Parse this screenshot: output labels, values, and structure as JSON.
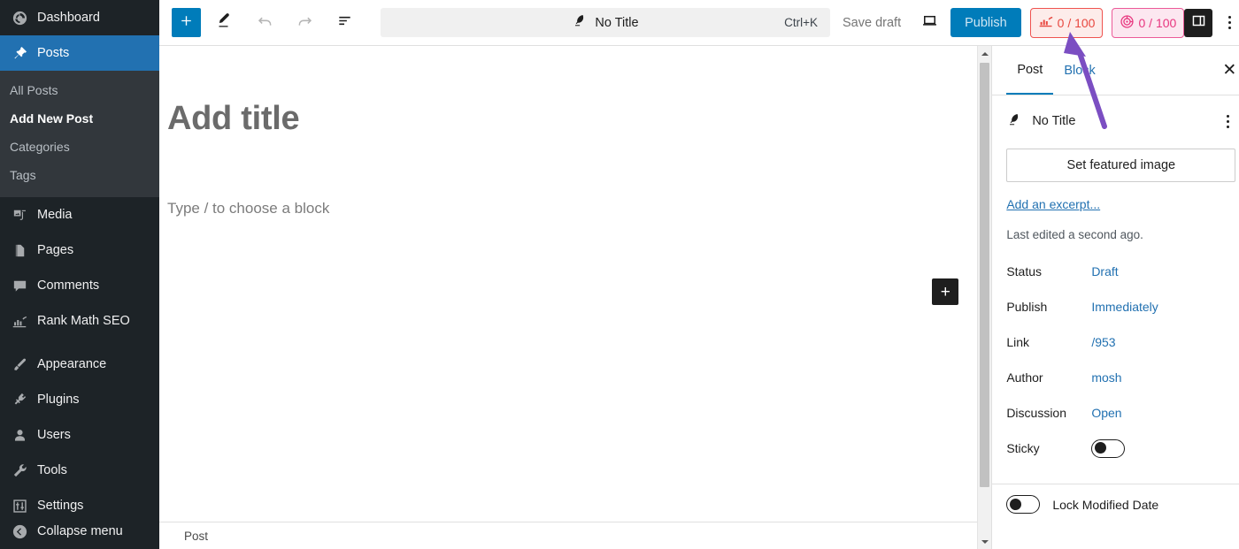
{
  "admin_sidebar": {
    "items": [
      {
        "label": "Dashboard",
        "icon": "dashboard-icon",
        "active": false
      },
      {
        "label": "Posts",
        "icon": "pin-icon",
        "active": true
      },
      {
        "label": "Media",
        "icon": "media-icon",
        "active": false
      },
      {
        "label": "Pages",
        "icon": "pages-icon",
        "active": false
      },
      {
        "label": "Comments",
        "icon": "comment-icon",
        "active": false
      },
      {
        "label": "Rank Math SEO",
        "icon": "rank-math-icon",
        "active": false
      },
      {
        "label": "Appearance",
        "icon": "brush-icon",
        "active": false
      },
      {
        "label": "Plugins",
        "icon": "plug-icon",
        "active": false
      },
      {
        "label": "Users",
        "icon": "user-icon",
        "active": false
      },
      {
        "label": "Tools",
        "icon": "wrench-icon",
        "active": false
      },
      {
        "label": "Settings",
        "icon": "sliders-icon",
        "active": false
      }
    ],
    "submenu": [
      {
        "label": "All Posts",
        "current": false
      },
      {
        "label": "Add New Post",
        "current": true
      },
      {
        "label": "Categories",
        "current": false
      },
      {
        "label": "Tags",
        "current": false
      }
    ],
    "collapse_label": "Collapse menu",
    "collapse_icon": "chevron-left-circle-icon",
    "accent_color": "#2271b1",
    "background_color": "#1d2327",
    "submenu_background": "#32373c"
  },
  "editor_header": {
    "add_block_icon": "plus-icon",
    "tools_icon": "pencil-icon",
    "undo_icon": "undo-arrow-icon",
    "redo_icon": "redo-arrow-icon",
    "outline_icon": "document-outline-icon",
    "command_bar": {
      "icon": "feather-quill-icon",
      "title": "No Title",
      "shortcut": "Ctrl+K"
    },
    "save_draft_label": "Save draft",
    "preview_icon": "laptop-preview-icon",
    "publish_label": "Publish",
    "badges": [
      {
        "name": "rank-math-seo-score",
        "icon": "rank-math-bars-icon",
        "value": "0 / 100",
        "border_color": "#ef5350",
        "background_color": "#fdecea",
        "text_color": "#e8473f"
      },
      {
        "name": "content-ai-score",
        "icon": "content-ai-target-icon",
        "value": "0 / 100",
        "border_color": "#ec5a98",
        "background_color": "#fce7f0",
        "text_color": "#e8367f"
      }
    ],
    "settings_toggle_icon": "sidebar-panel-icon",
    "options_icon": "kebab-menu-icon"
  },
  "editor_canvas": {
    "title_placeholder": "Add title",
    "block_placeholder": "Type / to choose a block",
    "inserter_icon": "plus-icon",
    "breadcrumb": "Post"
  },
  "settings_panel": {
    "tabs": [
      {
        "label": "Post",
        "active": true
      },
      {
        "label": "Block",
        "active": false
      }
    ],
    "close_icon": "close-icon",
    "document_icon": "feather-quill-icon",
    "document_title": "No Title",
    "document_actions_icon": "kebab-menu-icon",
    "featured_image_label": "Set featured image",
    "excerpt_link": "Add an excerpt...",
    "last_edited": "Last edited a second ago.",
    "meta": [
      {
        "label": "Status",
        "value": "Draft",
        "type": "link"
      },
      {
        "label": "Publish",
        "value": "Immediately",
        "type": "link"
      },
      {
        "label": "Link",
        "value": "/953",
        "type": "link"
      },
      {
        "label": "Author",
        "value": "mosh",
        "type": "link"
      },
      {
        "label": "Discussion",
        "value": "Open",
        "type": "link"
      },
      {
        "label": "Sticky",
        "value": "off",
        "type": "toggle"
      }
    ],
    "lock_modified_date": {
      "label": "Lock Modified Date",
      "value": "off"
    }
  },
  "annotation": {
    "type": "arrow",
    "color": "#7b4ec2",
    "points_to": "rank-math-seo-score"
  }
}
